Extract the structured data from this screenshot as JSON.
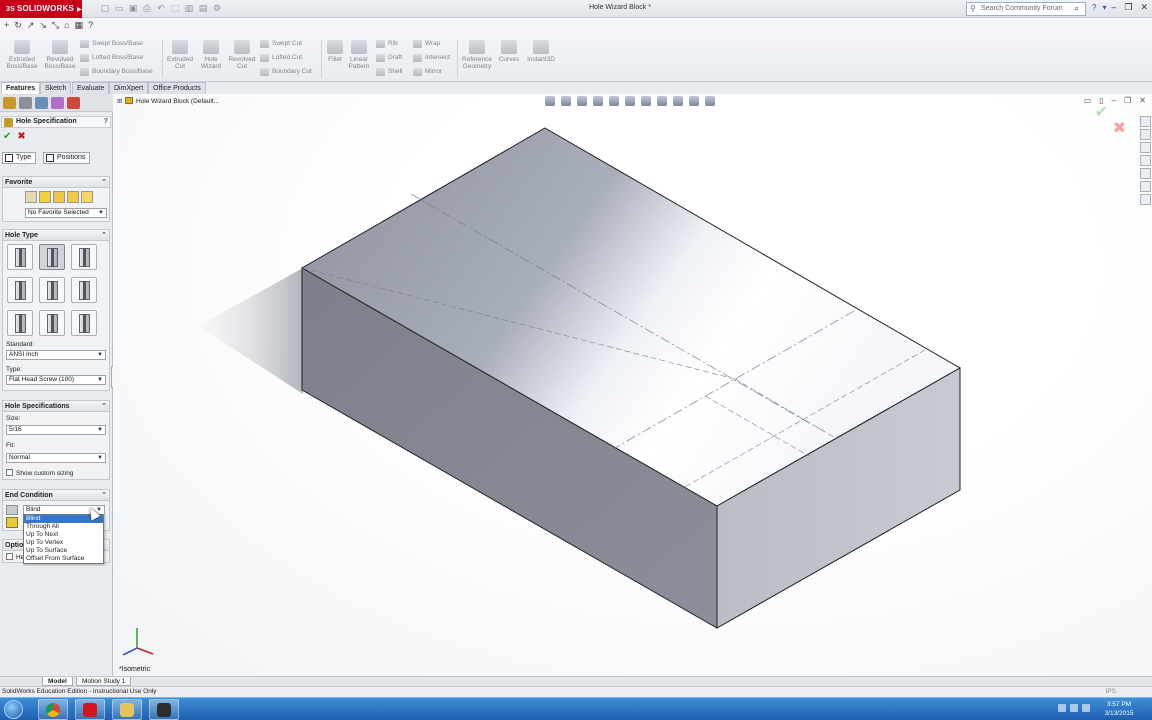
{
  "app": {
    "brand": "SOLIDWORKS",
    "document_title": "Hole Wizard Block *",
    "search_placeholder": "Search Community Forum"
  },
  "command_manager": {
    "large_tools": [
      {
        "id": "extruded-boss",
        "label": "Extruded Boss/Base"
      },
      {
        "id": "revolved-boss",
        "label": "Revolved Boss/Base"
      },
      {
        "id": "extruded-cut",
        "label": "Extruded Cut"
      },
      {
        "id": "hole-wizard",
        "label": "Hole Wizard"
      },
      {
        "id": "revolved-cut",
        "label": "Revolved Cut"
      },
      {
        "id": "fillet",
        "label": "Fillet"
      },
      {
        "id": "linear-pattern",
        "label": "Linear Pattern"
      },
      {
        "id": "reference-geometry",
        "label": "Reference Geometry"
      },
      {
        "id": "curves",
        "label": "Curves"
      },
      {
        "id": "instant3d",
        "label": "Instant3D"
      }
    ],
    "small_tools": {
      "swept_boss": "Swept Boss/Base",
      "lofted_boss": "Lofted Boss/Base",
      "boundary_boss": "Boundary Boss/Base",
      "swept_cut": "Swept Cut",
      "lofted_cut": "Lofted Cut",
      "boundary_cut": "Boundary Cut",
      "rib": "Rib",
      "draft": "Draft",
      "shell": "Shell",
      "wrap": "Wrap",
      "intersect": "Intersect",
      "mirror": "Mirror"
    }
  },
  "tabs": [
    "Features",
    "Sketch",
    "Evaluate",
    "DimXpert",
    "Office Products"
  ],
  "property_manager": {
    "title": "Hole Specification",
    "help": "?",
    "subtabs": {
      "type": "Type",
      "positions": "Positions"
    },
    "favorite": {
      "header": "Favorite",
      "selected": "No Favorite Selected"
    },
    "hole_type": {
      "header": "Hole Type",
      "standard_label": "Standard:",
      "standard_value": "ANSI Inch",
      "type_label": "Type:",
      "type_value": "Flat Head Screw (100)"
    },
    "hole_specs": {
      "header": "Hole Specifications",
      "size_label": "Size:",
      "size_value": "5/16",
      "fit_label": "Fit:",
      "fit_value": "Normal",
      "custom_sizing": "Show custom sizing"
    },
    "end_condition": {
      "header": "End Condition",
      "selected": "Blind",
      "options": [
        "Blind",
        "Through All",
        "Up To Next",
        "Up To Vertex",
        "Up To Surface",
        "Offset From Surface"
      ]
    },
    "options_fragment": "Optio",
    "options_item_fragment": "He"
  },
  "viewport": {
    "tree_item": "Hole Wizard Block  (Default...",
    "view_name": "*Isometric"
  },
  "bottom_tabs": [
    "Model",
    "Motion Study 1"
  ],
  "status": {
    "left": "SolidWorks Education Edition - Instructional Use Only",
    "right": "IPS"
  },
  "taskbar": {
    "time": "3:57 PM",
    "date": "3/13/2015"
  },
  "colors": {
    "brand_red": "#c8001a",
    "ok_green": "#2b9a2b",
    "cancel_red": "#c1121f",
    "taskbar_blue": "#1f5fb0",
    "selection_blue": "#3377cc"
  }
}
